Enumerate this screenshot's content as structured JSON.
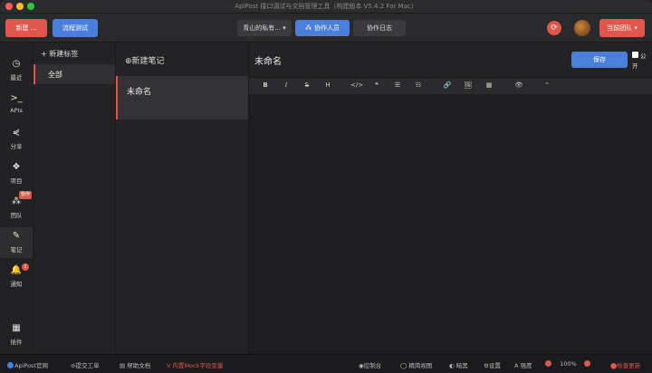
{
  "window": {
    "title": "ApiPost 接口调试与文档管理工具（构建版本 V5.4.2 For Mac）"
  },
  "toolbar": {
    "new_label": "新建 ...",
    "flow_label": "流程测试",
    "project_label": "青山的私有... ▾",
    "collab_label": "协作人员",
    "log_label": "协作日志",
    "team_label": "当前团队 ▾"
  },
  "nav": {
    "items": [
      {
        "label": "最近",
        "icon": "clock-icon",
        "glyph": "◷"
      },
      {
        "label": "APIs",
        "icon": "terminal-icon",
        "glyph": ">_"
      },
      {
        "label": "分享",
        "icon": "share-icon",
        "glyph": "⋞"
      },
      {
        "label": "项目",
        "icon": "project-icon",
        "glyph": "❖"
      },
      {
        "label": "团队",
        "icon": "team-icon",
        "glyph": "⁂",
        "badge": "协作"
      },
      {
        "label": "笔记",
        "icon": "note-icon",
        "glyph": "✎"
      },
      {
        "label": "通知",
        "icon": "bell-icon",
        "glyph": "🔔",
        "badge": "1"
      },
      {
        "label": "插件",
        "icon": "plugin-icon",
        "glyph": "▦"
      }
    ]
  },
  "tags": {
    "new_label": "+ 新建标签",
    "all_label": "全部"
  },
  "notes": {
    "new_label": "⊕新建笔记",
    "items": [
      {
        "title": "未命名"
      }
    ]
  },
  "editor": {
    "title": "未命名",
    "save_label": "保存",
    "public_label_1": "公",
    "public_label_2": "开",
    "tools": [
      "B",
      "I",
      "S",
      "H",
      "</>",
      "❝",
      "☰",
      "☷",
      "🔗",
      "🖼",
      "▦",
      "👁",
      "⌃"
    ]
  },
  "status": {
    "items": [
      {
        "label": "ApiPost官网",
        "icon": "ApiPost"
      },
      {
        "label": "提交工单"
      },
      {
        "label": "帮助文档"
      },
      {
        "label": "内置Mock字段变量"
      },
      {
        "label": "控制台"
      },
      {
        "label": "精简视图"
      },
      {
        "label": "暗黑"
      },
      {
        "label": "设置"
      },
      {
        "label": "A 强度"
      },
      {
        "label": "100%"
      },
      {
        "label": "检查更新"
      }
    ]
  },
  "colors": {
    "accent_red": "#e0564b",
    "accent_blue": "#4a7fdc",
    "bg": "#232325"
  }
}
